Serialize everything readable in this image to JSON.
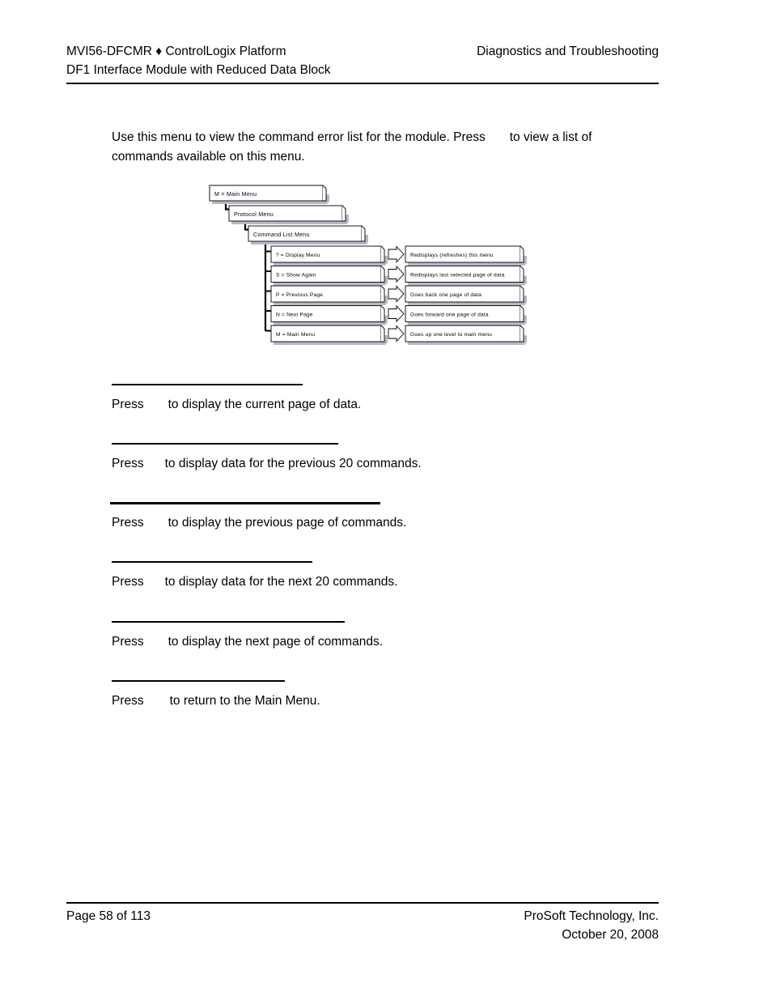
{
  "header": {
    "left_line1": "MVI56-DFCMR ♦ ControlLogix Platform",
    "left_line2": "DF1 Interface Module with Reduced Data Block",
    "right": "Diagnostics and Troubleshooting"
  },
  "intro": {
    "part1": "Use this menu to view the command error list for the module. Press",
    "part2": "to view a list of commands available on this menu."
  },
  "diagram": {
    "title": "Command List Menu navigation tree",
    "breadcrumb": [
      {
        "label": "M = Main Menu"
      },
      {
        "label": "Protocol Menu"
      },
      {
        "label": "Command List Menu"
      }
    ],
    "commands": [
      {
        "key": "? = Display Menu",
        "description": "Redisplays (refreshes) this menu"
      },
      {
        "key": "S = Show Again",
        "description": "Redisplays last selected page of data"
      },
      {
        "key": "P = Previous Page",
        "description": "Goes back one page of data"
      },
      {
        "key": "N = Next Page",
        "description": "Goes forward one page of data"
      },
      {
        "key": "M = Main Menu",
        "description": "Goes up one level to main menu"
      }
    ]
  },
  "sections": [
    {
      "heading": "",
      "press": "Press",
      "text": "to display the current page of data."
    },
    {
      "heading": "",
      "press": "Press",
      "text": "to display data for the previous 20 commands."
    },
    {
      "heading": "",
      "press": "Press",
      "text": "to display the previous page of commands."
    },
    {
      "heading": "",
      "press": "Press",
      "text": "to display data for the next 20 commands."
    },
    {
      "heading": "",
      "press": "Press",
      "text": "to display the next page of commands."
    },
    {
      "heading": "",
      "press": "Press",
      "text": "to return to the Main Menu."
    }
  ],
  "footer": {
    "page": "Page 58 of 113",
    "company": "ProSoft Technology, Inc.",
    "date": "October 20, 2008"
  },
  "colors": {
    "text": "#000000",
    "rule": "#000000",
    "box_fill": "#ffffff",
    "box_stroke": "#000000",
    "box_shadow": "#b8b8c8",
    "connector": "#000000"
  }
}
